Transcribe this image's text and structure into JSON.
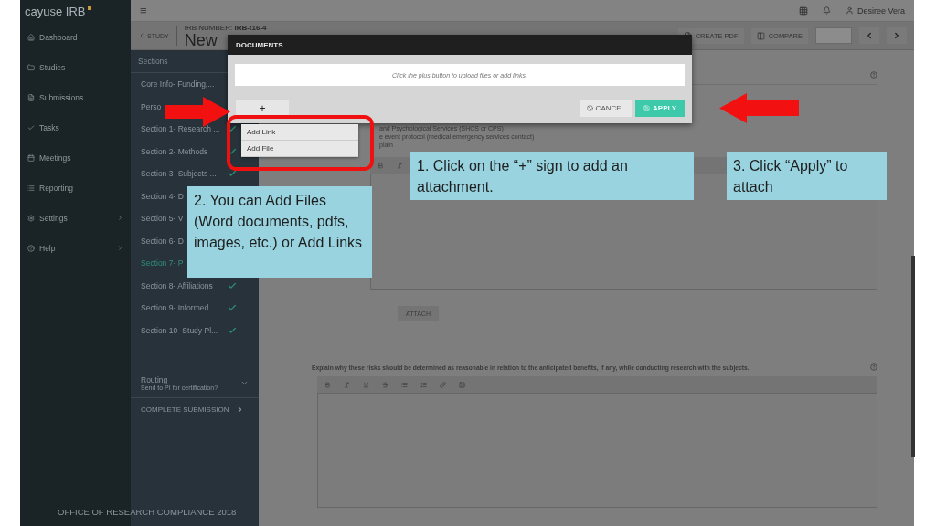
{
  "brand": {
    "name": "cayuse IRB"
  },
  "nav": [
    {
      "label": "Dashboard",
      "submenu": false
    },
    {
      "label": "Studies",
      "submenu": false
    },
    {
      "label": "Submissions",
      "submenu": false
    },
    {
      "label": "Tasks",
      "submenu": false
    },
    {
      "label": "Meetings",
      "submenu": false
    },
    {
      "label": "Reporting",
      "submenu": false
    },
    {
      "label": "Settings",
      "submenu": true
    },
    {
      "label": "Help",
      "submenu": true
    }
  ],
  "top_bar": {
    "menu": "≡",
    "user": "Desiree Vera"
  },
  "header": {
    "back": "STUDY",
    "irb_label": "IRB NUMBER:",
    "irb_number": "IRB-t16-4",
    "title": "New",
    "actions": [
      "CREATE PDF",
      "COMPARE"
    ]
  },
  "sections": {
    "heading": "Sections",
    "items": [
      {
        "label": "Core Info- Funding,...",
        "complete": false,
        "selected": false
      },
      {
        "label": "Perso",
        "complete": false,
        "selected": false
      },
      {
        "label": "Section 1- Research ...",
        "complete": true,
        "selected": false
      },
      {
        "label": "Section 2- Methods",
        "complete": true,
        "selected": false
      },
      {
        "label": "Section 3- Subjects ...",
        "complete": true,
        "selected": false
      },
      {
        "label": "Section 4- D",
        "complete": false,
        "selected": false
      },
      {
        "label": "Section 5- V",
        "complete": false,
        "selected": false
      },
      {
        "label": "Section 6- D",
        "complete": false,
        "selected": false
      },
      {
        "label": "Section 7- P",
        "complete": false,
        "selected": true
      },
      {
        "label": "Section 8- Affiliations",
        "complete": true,
        "selected": false
      },
      {
        "label": "Section 9- Informed ...",
        "complete": true,
        "selected": false
      },
      {
        "label": "Section 10- Study Pl...",
        "complete": true,
        "selected": false
      }
    ],
    "routing": {
      "title": "Routing",
      "subtitle": "Send to PI for certification?"
    },
    "complete_submission": "COMPLETE SUBMISSION"
  },
  "main": {
    "question_lines": [
      "and Psychological Services (SHCS or CPS)",
      "e event protocol (medical emergency services contact)",
      "plain"
    ],
    "attach": "ATTACH",
    "question_2": "Explain why these risks should be determined as reasonable in relation to the anticipated benefits, if any, while conducting research with the subjects."
  },
  "modal": {
    "title": "DOCUMENTS",
    "drop_hint": "Click the plus button to upload files or add links.",
    "add": "+",
    "cancel": "CANCEL",
    "apply": "APPLY"
  },
  "menu": [
    {
      "label": "Add Link"
    },
    {
      "label": "Add File"
    }
  ],
  "callouts": [
    "1. Click on the “+” sign to add an attachment.",
    "2. You can Add Files (Word documents, pdfs, images, etc.) or Add Links",
    "3. Click “Apply” to attach"
  ],
  "footer": "OFFICE OF RESEARCH COMPLIANCE 2018"
}
